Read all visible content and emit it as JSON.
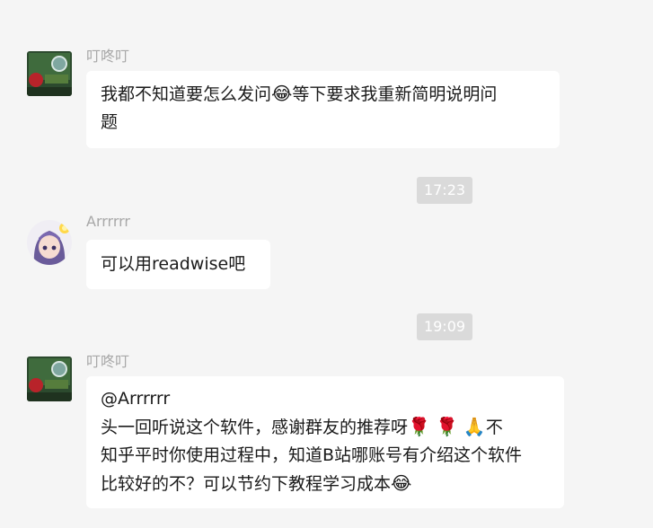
{
  "messages": [
    {
      "sender": "叮咚叮",
      "lines": [
        "我都不知道要怎么发问",
        "等下要求我重新简明说明问",
        "题"
      ],
      "emoji": "😂"
    },
    {
      "time": "17:23"
    },
    {
      "sender": "Arrrrrr",
      "lines": [
        "可以用readwise吧"
      ]
    },
    {
      "time": "19:09"
    },
    {
      "sender": "叮咚叮",
      "mention": "@Arrrrrr",
      "lines": [
        "头一回听说这个软件，感谢群友的推荐呀",
        "不",
        "知乎平时你使用过程中，知道B站哪账号有介绍这个软件",
        "比较好的不？可以节约下教程学习成本"
      ],
      "emojis": [
        "🌹",
        "🌹",
        "🙏",
        "😂"
      ]
    }
  ],
  "colors": {
    "background": "#f5f5f5",
    "bubble": "#ffffff",
    "sender_name": "#a8a8a8",
    "timestamp_bg": "#dadada"
  }
}
